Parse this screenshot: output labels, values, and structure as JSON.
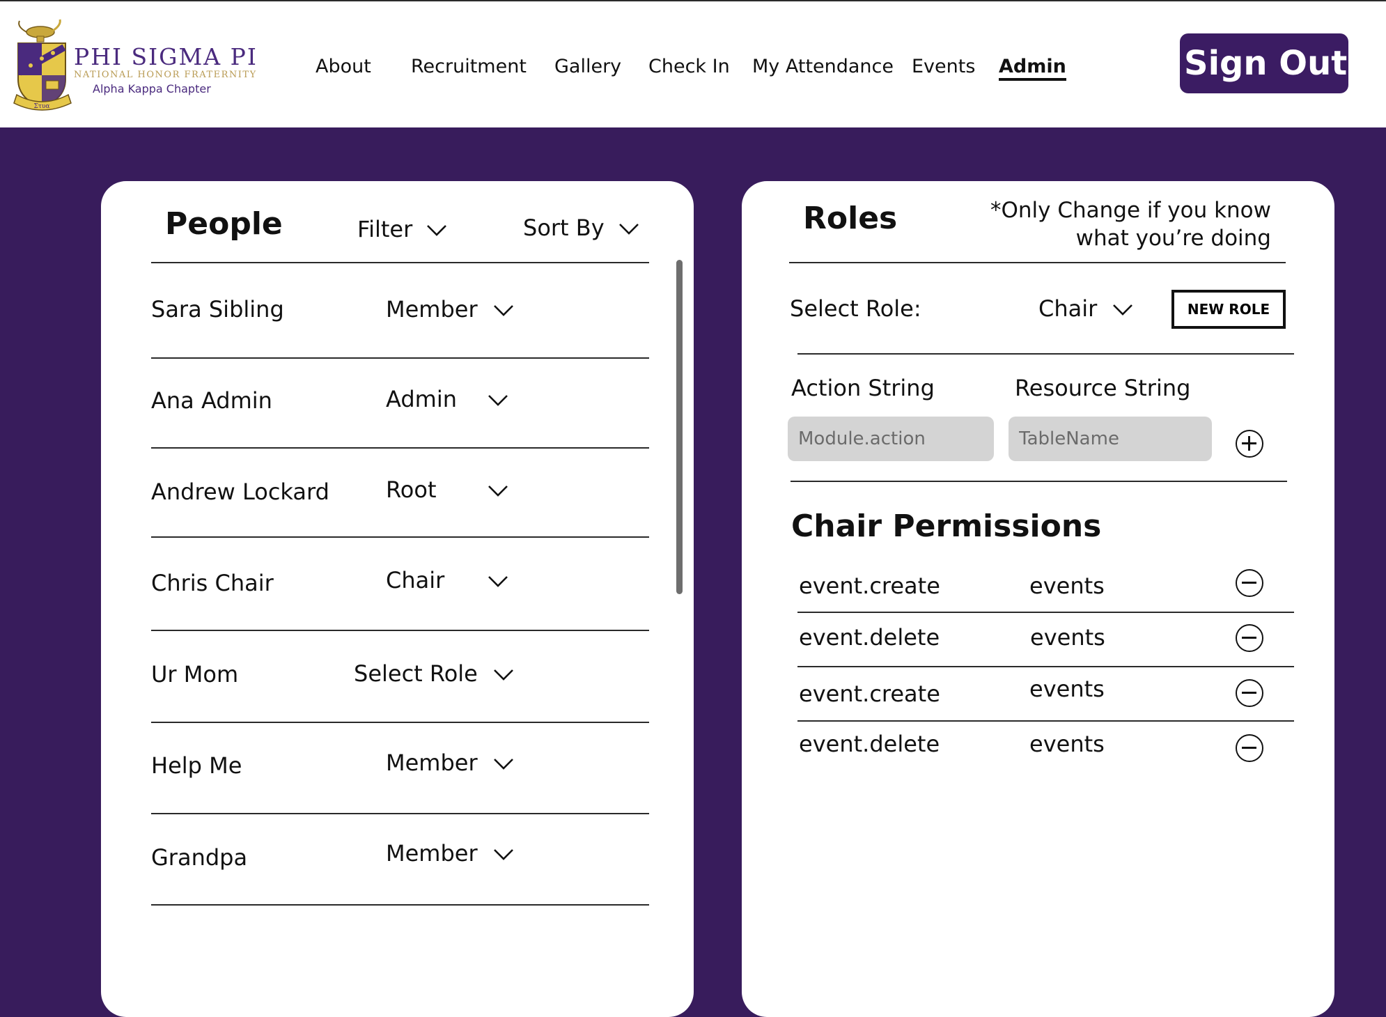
{
  "brand": {
    "name": "PHI SIGMA PI",
    "subtitle": "NATIONAL HONOR FRATERNITY",
    "chapter": "Alpha Kappa Chapter",
    "crest_motto": "Στυα"
  },
  "nav": {
    "items": [
      "About",
      "Recruitment",
      "Gallery",
      "Check In",
      "My Attendance",
      "Events",
      "Admin"
    ],
    "active": "Admin",
    "sign_out": "Sign Out"
  },
  "people": {
    "title": "People",
    "filter_label": "Filter",
    "sort_label": "Sort By",
    "rows": [
      {
        "name": "Sara Sibling",
        "role": "Member"
      },
      {
        "name": "Ana Admin",
        "role": "Admin"
      },
      {
        "name": "Andrew Lockard",
        "role": "Root"
      },
      {
        "name": "Chris Chair",
        "role": "Chair"
      },
      {
        "name": "Ur Mom",
        "role": "Select Role"
      },
      {
        "name": "Help Me",
        "role": "Member"
      },
      {
        "name": "Grandpa",
        "role": "Member"
      }
    ]
  },
  "roles": {
    "title": "Roles",
    "note_line1": "*Only Change if you know",
    "note_line2": "what you’re doing",
    "select_label": "Select Role:",
    "selected_role": "Chair",
    "new_role_label": "NEW ROLE",
    "action_label": "Action String",
    "resource_label": "Resource String",
    "action_placeholder": "Module.action",
    "resource_placeholder": "TableName",
    "permissions_title": "Chair Permissions",
    "permissions": [
      {
        "action": "event.create",
        "resource": "events"
      },
      {
        "action": "event.delete",
        "resource": "events"
      },
      {
        "action": "event.create",
        "resource": "events"
      },
      {
        "action": "event.delete",
        "resource": "events"
      }
    ]
  },
  "colors": {
    "brand_purple": "#381c5c",
    "button_purple": "#3b1c63",
    "gold": "#b89a52",
    "input_gray": "#d4d4d4"
  }
}
